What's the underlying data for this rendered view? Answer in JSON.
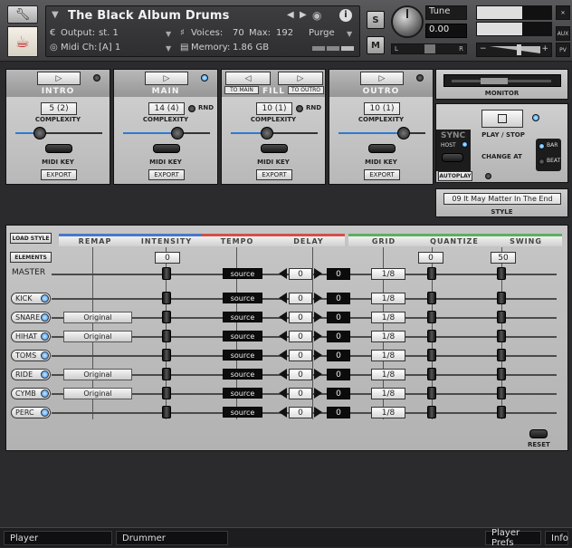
{
  "header": {
    "instrument_title": "The Black Album Drums",
    "output_label": "Output:",
    "output_value": "st. 1",
    "voices_label": "Voices:",
    "voices_value": "70",
    "max_label": "Max:",
    "max_value": "192",
    "purge_label": "Purge",
    "midi_label": "Midi Ch:",
    "midi_value": "[A] 1",
    "memory_label": "Memory:",
    "memory_value": "1.86 GB",
    "solo_label": "S",
    "mute_label": "M",
    "tune_label": "Tune",
    "tune_value": "0.00",
    "pan_left": "L",
    "pan_right": "R",
    "aux_label": "AUX",
    "pv_label": "PV"
  },
  "sections": [
    {
      "name": "INTRO",
      "complexity": "5 (2)",
      "complexity_fraction": 0.28
    },
    {
      "name": "MAIN",
      "complexity": "14 (4)",
      "complexity_fraction": 0.62,
      "rnd": "RND"
    },
    {
      "name": "FILL",
      "complexity": "10 (1)",
      "complexity_fraction": 0.42,
      "rnd": "RND",
      "to_main": "TO MAIN",
      "to_outro": "TO OUTRO"
    },
    {
      "name": "OUTRO",
      "complexity": "10 (1)",
      "complexity_fraction": 0.75
    }
  ],
  "section_labels": {
    "complexity": "COMPLEXITY",
    "midi_key": "MIDI KEY",
    "export": "EXPORT"
  },
  "monitor": {
    "label": "MONITOR"
  },
  "transport": {
    "play_stop": "PLAY / STOP",
    "sync": "SYNC",
    "host": "HOST",
    "change_at": "CHANGE AT",
    "bar": "BAR",
    "beat": "BEAT",
    "autoplay": "AUTOPLAY"
  },
  "style": {
    "value": "09 It May Matter In The End",
    "label": "STYLE"
  },
  "grid": {
    "load_style": "LOAD STYLE",
    "elements": "ELEMENTS",
    "columns": [
      "REMAP",
      "INTENSITY",
      "TEMPO",
      "DELAY",
      "GRID",
      "QUANTIZE",
      "SWING"
    ],
    "master": {
      "label": "MASTER",
      "intensity": "0",
      "tempo": "source",
      "delay_a": "0",
      "delay_b": "0",
      "grid": "1/8",
      "quantize": "0",
      "swing": "50"
    },
    "rows": [
      {
        "name": "KICK",
        "remap": "",
        "tempo": "source",
        "delay_a": "0",
        "delay_b": "0",
        "grid": "1/8"
      },
      {
        "name": "SNARE",
        "remap": "Original",
        "tempo": "source",
        "delay_a": "0",
        "delay_b": "0",
        "grid": "1/8"
      },
      {
        "name": "HIHAT",
        "remap": "Original",
        "tempo": "source",
        "delay_a": "0",
        "delay_b": "0",
        "grid": "1/8"
      },
      {
        "name": "TOMS",
        "remap": "",
        "tempo": "source",
        "delay_a": "0",
        "delay_b": "0",
        "grid": "1/8"
      },
      {
        "name": "RIDE",
        "remap": "Original",
        "tempo": "source",
        "delay_a": "0",
        "delay_b": "0",
        "grid": "1/8"
      },
      {
        "name": "CYMB",
        "remap": "Original",
        "tempo": "source",
        "delay_a": "0",
        "delay_b": "0",
        "grid": "1/8"
      },
      {
        "name": "PERC",
        "remap": "",
        "tempo": "source",
        "delay_a": "0",
        "delay_b": "0",
        "grid": "1/8"
      }
    ],
    "reset": "RESET"
  },
  "footer": {
    "player": "Player",
    "drummer": "Drummer",
    "player_prefs": "Player Prefs",
    "info": "Info"
  },
  "colors": {
    "accent_blue": "#2a7bd4",
    "led_blue": "#3a90e8"
  }
}
